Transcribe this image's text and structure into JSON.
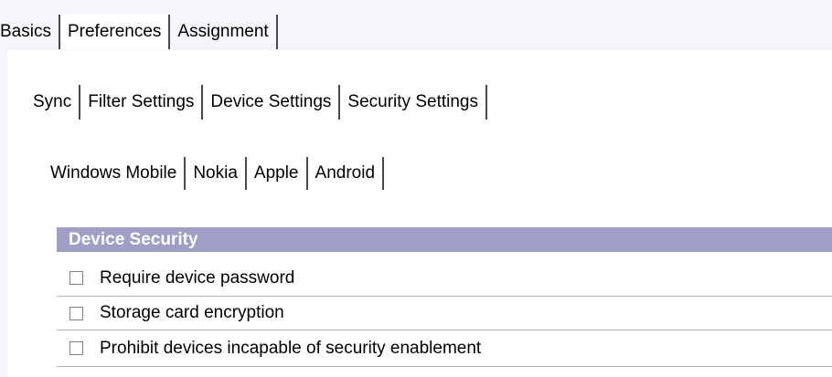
{
  "top_tabs": [
    {
      "label": "Basics",
      "active": false
    },
    {
      "label": "Preferences",
      "active": true
    },
    {
      "label": "Assignment",
      "active": false
    }
  ],
  "preference_tabs": [
    {
      "label": "Sync",
      "active": false
    },
    {
      "label": "Filter Settings",
      "active": false
    },
    {
      "label": "Device Settings",
      "active": false
    },
    {
      "label": "Security Settings",
      "active": true
    }
  ],
  "platform_tabs": [
    {
      "label": "Windows Mobile",
      "active": true
    },
    {
      "label": "Nokia",
      "active": false
    },
    {
      "label": "Apple",
      "active": false
    },
    {
      "label": "Android",
      "active": false
    }
  ],
  "device_security": {
    "title": "Device Security",
    "options": [
      {
        "label": "Require device password",
        "checked": false
      },
      {
        "label": "Storage card encryption",
        "checked": false
      },
      {
        "label": "Prohibit devices incapable of security enablement",
        "checked": false
      }
    ]
  },
  "colors": {
    "section_header_bg": "#9f9fc6",
    "section_header_text": "#ffffff",
    "backdrop_top": "#b9d2ec"
  }
}
